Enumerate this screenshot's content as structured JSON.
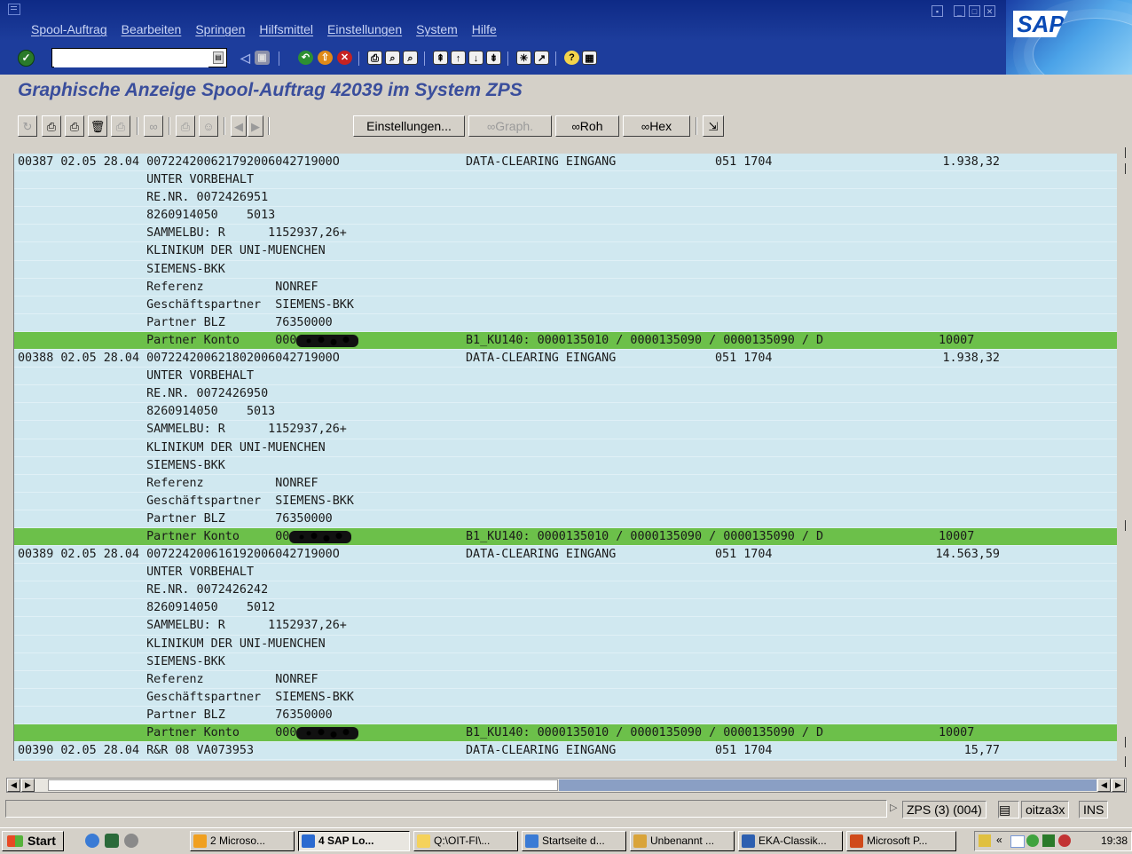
{
  "menu": [
    "Spool-Auftrag",
    "Bearbeiten",
    "Springen",
    "Hilfsmittel",
    "Einstellungen",
    "System",
    "Hilfe"
  ],
  "command_field": {
    "value": ""
  },
  "screen_title": "Graphische Anzeige Spool-Auftrag 42039 im System ZPS",
  "app_toolbar": {
    "settings": "Einstellungen...",
    "graph": "Graph.",
    "raw": "Roh",
    "hex": "Hex"
  },
  "list_rows": [
    {
      "a": "00387 02.05 28.04 00722420062179200604271900O",
      "b": "DATA-CLEARING EINGANG",
      "c": "051 1704",
      "d": "1.938,32",
      "green": false
    },
    {
      "a": "                  UNTER VORBEHALT",
      "b": "",
      "c": "",
      "d": "",
      "green": false
    },
    {
      "a": "                  RE.NR. 0072426951",
      "b": "",
      "c": "",
      "d": "",
      "green": false
    },
    {
      "a": "                  8260914050    5013",
      "b": "",
      "c": "",
      "d": "",
      "green": false
    },
    {
      "a": "                  SAMMELBU: R      1152937,26+",
      "b": "",
      "c": "",
      "d": "",
      "green": false
    },
    {
      "a": "                  KLINIKUM DER UNI-MUENCHEN",
      "b": "",
      "c": "",
      "d": "",
      "green": false
    },
    {
      "a": "                  SIEMENS-BKK",
      "b": "",
      "c": "",
      "d": "",
      "green": false
    },
    {
      "a": "                  Referenz          NONREF",
      "b": "",
      "c": "",
      "d": "",
      "green": false
    },
    {
      "a": "                  Geschäftspartner  SIEMENS-BKK",
      "b": "",
      "c": "",
      "d": "",
      "green": false
    },
    {
      "a": "                  Partner BLZ       76350000",
      "b": "",
      "c": "",
      "d": "",
      "green": false
    },
    {
      "a": "                  Partner Konto     000",
      "b": "B1_KU140: 0000135010 / 0000135090 / 0000135090 / D",
      "c": "",
      "d": "10007",
      "green": true,
      "scribble": true
    },
    {
      "a": "00388 02.05 28.04 00722420062180200604271900O",
      "b": "DATA-CLEARING EINGANG",
      "c": "051 1704",
      "d": "1.938,32",
      "green": false
    },
    {
      "a": "                  UNTER VORBEHALT",
      "b": "",
      "c": "",
      "d": "",
      "green": false
    },
    {
      "a": "                  RE.NR. 0072426950",
      "b": "",
      "c": "",
      "d": "",
      "green": false
    },
    {
      "a": "                  8260914050    5013",
      "b": "",
      "c": "",
      "d": "",
      "green": false
    },
    {
      "a": "                  SAMMELBU: R      1152937,26+",
      "b": "",
      "c": "",
      "d": "",
      "green": false
    },
    {
      "a": "                  KLINIKUM DER UNI-MUENCHEN",
      "b": "",
      "c": "",
      "d": "",
      "green": false
    },
    {
      "a": "                  SIEMENS-BKK",
      "b": "",
      "c": "",
      "d": "",
      "green": false
    },
    {
      "a": "                  Referenz          NONREF",
      "b": "",
      "c": "",
      "d": "",
      "green": false
    },
    {
      "a": "                  Geschäftspartner  SIEMENS-BKK",
      "b": "",
      "c": "",
      "d": "",
      "green": false
    },
    {
      "a": "                  Partner BLZ       76350000",
      "b": "",
      "c": "",
      "d": "",
      "green": false
    },
    {
      "a": "                  Partner Konto     00",
      "b": "B1_KU140: 0000135010 / 0000135090 / 0000135090 / D",
      "c": "",
      "d": "10007",
      "green": true,
      "scribble": true
    },
    {
      "a": "00389 02.05 28.04 00722420061619200604271900O",
      "b": "DATA-CLEARING EINGANG",
      "c": "051 1704",
      "d": "14.563,59",
      "green": false
    },
    {
      "a": "                  UNTER VORBEHALT",
      "b": "",
      "c": "",
      "d": "",
      "green": false
    },
    {
      "a": "                  RE.NR. 0072426242",
      "b": "",
      "c": "",
      "d": "",
      "green": false
    },
    {
      "a": "                  8260914050    5012",
      "b": "",
      "c": "",
      "d": "",
      "green": false
    },
    {
      "a": "                  SAMMELBU: R      1152937,26+",
      "b": "",
      "c": "",
      "d": "",
      "green": false
    },
    {
      "a": "                  KLINIKUM DER UNI-MUENCHEN",
      "b": "",
      "c": "",
      "d": "",
      "green": false
    },
    {
      "a": "                  SIEMENS-BKK",
      "b": "",
      "c": "",
      "d": "",
      "green": false
    },
    {
      "a": "                  Referenz          NONREF",
      "b": "",
      "c": "",
      "d": "",
      "green": false
    },
    {
      "a": "                  Geschäftspartner  SIEMENS-BKK",
      "b": "",
      "c": "",
      "d": "",
      "green": false
    },
    {
      "a": "                  Partner BLZ       76350000",
      "b": "",
      "c": "",
      "d": "",
      "green": false
    },
    {
      "a": "                  Partner Konto     000",
      "b": "B1_KU140: 0000135010 / 0000135090 / 0000135090 / D",
      "c": "",
      "d": "10007",
      "green": true,
      "scribble": true
    },
    {
      "a": "00390 02.05 28.04 R&R 08 VA073953",
      "b": "DATA-CLEARING EINGANG",
      "c": "051 1704",
      "d": "15,77",
      "green": false
    }
  ],
  "status": {
    "system": "ZPS (3) (004)",
    "host": "oitza3x",
    "mode": "INS"
  },
  "taskbar": {
    "start": "Start",
    "tasks": [
      "2 Microso...",
      "4 SAP Lo...",
      "Q:\\OIT-FI\\...",
      "Startseite d...",
      "Unbenannt ...",
      "EKA-Classik...",
      "Microsoft P..."
    ],
    "clock": "19:38"
  }
}
